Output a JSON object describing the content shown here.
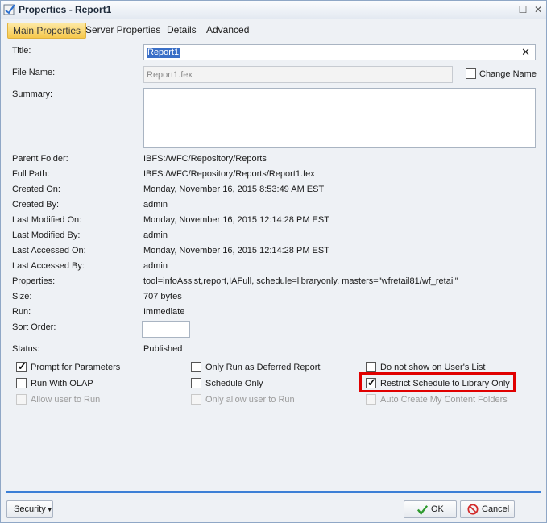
{
  "window": {
    "title": "Properties - Report1",
    "maximize_glyph": "☐",
    "close_glyph": "✕"
  },
  "tabs": [
    {
      "label": "Main Properties",
      "active": true
    },
    {
      "label": "Server Properties",
      "active": false
    },
    {
      "label": "Details",
      "active": false
    },
    {
      "label": "Advanced",
      "active": false
    }
  ],
  "form": {
    "title_label": "Title:",
    "title_value": "Report1",
    "clear_glyph": "✕",
    "filename_label": "File Name:",
    "filename_value": "Report1.fex",
    "change_name_label": "Change Name",
    "summary_label": "Summary:",
    "summary_value": ""
  },
  "info": [
    {
      "label": "Parent Folder:",
      "value": "IBFS:/WFC/Repository/Reports"
    },
    {
      "label": "Full Path:",
      "value": "IBFS:/WFC/Repository/Reports/Report1.fex"
    },
    {
      "label": "Created On:",
      "value": "Monday, November 16, 2015 8:53:49 AM EST"
    },
    {
      "label": "Created By:",
      "value": "admin"
    },
    {
      "label": "Last Modified On:",
      "value": "Monday, November 16, 2015 12:14:28 PM EST"
    },
    {
      "label": "Last Modified By:",
      "value": "admin"
    },
    {
      "label": "Last Accessed On:",
      "value": "Monday, November 16, 2015 12:14:28 PM EST"
    },
    {
      "label": "Last Accessed By:",
      "value": "admin"
    },
    {
      "label": "Properties:",
      "value": "tool=infoAssist,report,IAFull, schedule=libraryonly, masters=\"wfretail81/wf_retail\""
    },
    {
      "label": "Size:",
      "value": "707 bytes"
    },
    {
      "label": "Run:",
      "value": "Immediate"
    }
  ],
  "sort_order": {
    "label": "Sort Order:",
    "value": ""
  },
  "status": {
    "label": "Status:",
    "value": "Published"
  },
  "options": [
    {
      "label": "Prompt for Parameters",
      "checked": true,
      "disabled": false
    },
    {
      "label": "Only Run as Deferred Report",
      "checked": false,
      "disabled": false
    },
    {
      "label": "Do not show on User's List",
      "checked": false,
      "disabled": false
    },
    {
      "label": "Run With OLAP",
      "checked": false,
      "disabled": false
    },
    {
      "label": "Schedule Only",
      "checked": false,
      "disabled": false
    },
    {
      "label": "Restrict Schedule to Library Only",
      "checked": true,
      "disabled": false
    },
    {
      "label": "Allow user to Run",
      "checked": false,
      "disabled": true
    },
    {
      "label": "Only allow user to Run",
      "checked": false,
      "disabled": true
    },
    {
      "label": "Auto Create My Content Folders",
      "checked": false,
      "disabled": true
    }
  ],
  "footer": {
    "security_label": "Security",
    "ok_label": "OK",
    "cancel_label": "Cancel"
  },
  "colors": {
    "active_tab": "#f6c84c",
    "highlight_border": "#e00000",
    "accent_bar": "#3c7fd6",
    "ok_check": "#2e9a2e",
    "cancel_icon": "#d22a2a"
  }
}
